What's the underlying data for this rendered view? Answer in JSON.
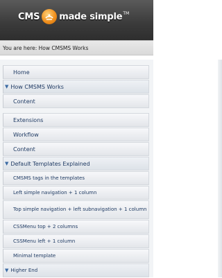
{
  "header": {
    "logo_left": "CMS",
    "logo_right": "made simple",
    "logo_tm": "TM"
  },
  "breadcrumb": {
    "text": "You are here: How CMSMS Works"
  },
  "nav": {
    "home": "Home",
    "how_cmsms_works": "How CMSMS Works",
    "content_1": "Content",
    "extensions": "Extensions",
    "workflow": "Workflow",
    "content_2": "Content",
    "default_templates": "Default Templates Explained",
    "sub": [
      "CMSMS tags in the templates",
      "Left simple navigation + 1 column",
      "Top simple navigation + left subnavigation + 1 column",
      "CSSMenu top + 2 columns",
      "CSSMenu left + 1 column",
      "Minimal template"
    ],
    "higher_end": "Higher End"
  },
  "colors": {
    "header_bg": "#3a3a3a",
    "link": "#1f3a63",
    "arrow": "#3a6aa3",
    "logo_accent": "#f0901e"
  }
}
